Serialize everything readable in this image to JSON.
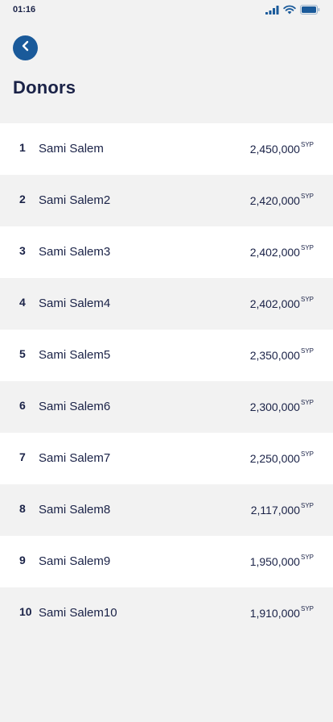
{
  "status_bar": {
    "time": "01:16",
    "icons": [
      "signal-icon",
      "wifi-icon",
      "battery-icon"
    ]
  },
  "header": {
    "back_icon": "chevron-left-icon",
    "title": "Donors"
  },
  "colors": {
    "accent": "#1a5a9a",
    "text": "#1a2247",
    "row_light": "#ffffff",
    "row_alt": "#f2f2f2"
  },
  "donors": [
    {
      "rank": "1",
      "name": "Sami Salem",
      "amount": "2,450,000",
      "currency": "SYP"
    },
    {
      "rank": "2",
      "name": "Sami Salem2",
      "amount": "2,420,000",
      "currency": "SYP"
    },
    {
      "rank": "3",
      "name": "Sami Salem3",
      "amount": "2,402,000",
      "currency": "SYP"
    },
    {
      "rank": "4",
      "name": "Sami Salem4",
      "amount": "2,402,000",
      "currency": "SYP"
    },
    {
      "rank": "5",
      "name": "Sami Salem5",
      "amount": "2,350,000",
      "currency": "SYP"
    },
    {
      "rank": "6",
      "name": "Sami Salem6",
      "amount": "2,300,000",
      "currency": "SYP"
    },
    {
      "rank": "7",
      "name": "Sami Salem7",
      "amount": "2,250,000",
      "currency": "SYP"
    },
    {
      "rank": "8",
      "name": "Sami Salem8",
      "amount": "2,117,000",
      "currency": "SYP"
    },
    {
      "rank": "9",
      "name": "Sami Salem9",
      "amount": "1,950,000",
      "currency": "SYP"
    },
    {
      "rank": "10",
      "name": "Sami Salem10",
      "amount": "1,910,000",
      "currency": "SYP"
    }
  ]
}
